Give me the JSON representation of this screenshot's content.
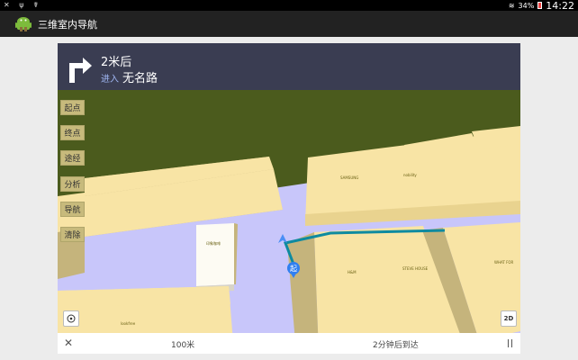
{
  "status_bar": {
    "left_icons": [
      "notification-icon",
      "usb-icon",
      "debug-icon"
    ],
    "battery_percent": "34%",
    "time": "14:22"
  },
  "app_bar": {
    "title": "三维室内导航",
    "icon": "android-icon"
  },
  "nav_banner": {
    "distance": "2米后",
    "enter_label": "进入",
    "road_name": "无名路",
    "turn_icon": "turn-right-arrow-icon"
  },
  "side_buttons": [
    {
      "label": "起点"
    },
    {
      "label": "终点"
    },
    {
      "label": "途经"
    },
    {
      "label": "分析"
    },
    {
      "label": "导航"
    },
    {
      "label": "清除"
    }
  ],
  "map": {
    "start_marker": "起",
    "view_mode_button": "2D",
    "building_labels": [
      "SAMSUNG",
      "nobility",
      "印象咖啡",
      "H&M",
      "STEVE HOUSE",
      "WHAT FOR",
      "lookfree"
    ],
    "colors": {
      "ground": "#c8c6fa",
      "building_top": "#f8e4a5",
      "building_side": "#c5b47c",
      "background": "#4b5b1d",
      "route": "#0e8aa0"
    }
  },
  "bottom_bar": {
    "remaining_distance": "100米",
    "arrive_time": "2分钟后到达"
  }
}
